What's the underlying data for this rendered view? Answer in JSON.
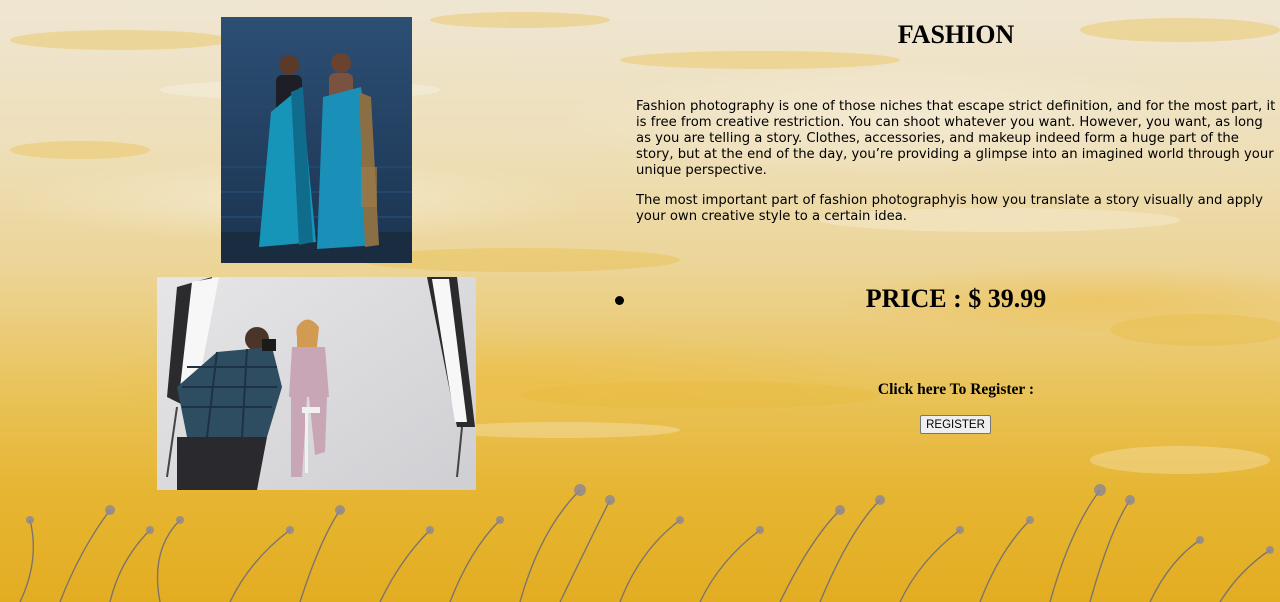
{
  "page": {
    "title": "FASHION",
    "paragraphs": [
      "Fashion photography is one of those niches that escape strict definition, and for the most part, it is free from creative restriction. You can shoot whatever you want. However, you want, as long as you are telling a story. Clothes, accessories, and makeup indeed form a huge part of the story, but at the end of the day, you’re providing a glimpse into an imagined world through your unique perspective.",
      "The most important part of fashion photographyis how you translate a story visually and apply your own creative style to a certain idea."
    ],
    "price": "PRICE : $ 39.99",
    "register_prompt": "Click here To Register :",
    "register_button": "REGISTER"
  },
  "images": [
    {
      "name": "saree-models-photo"
    },
    {
      "name": "studio-photoshoot-photo"
    }
  ],
  "colors": {
    "background_top": "#efe6d3",
    "background_bottom": "#e3ad22",
    "text": "#000000"
  }
}
